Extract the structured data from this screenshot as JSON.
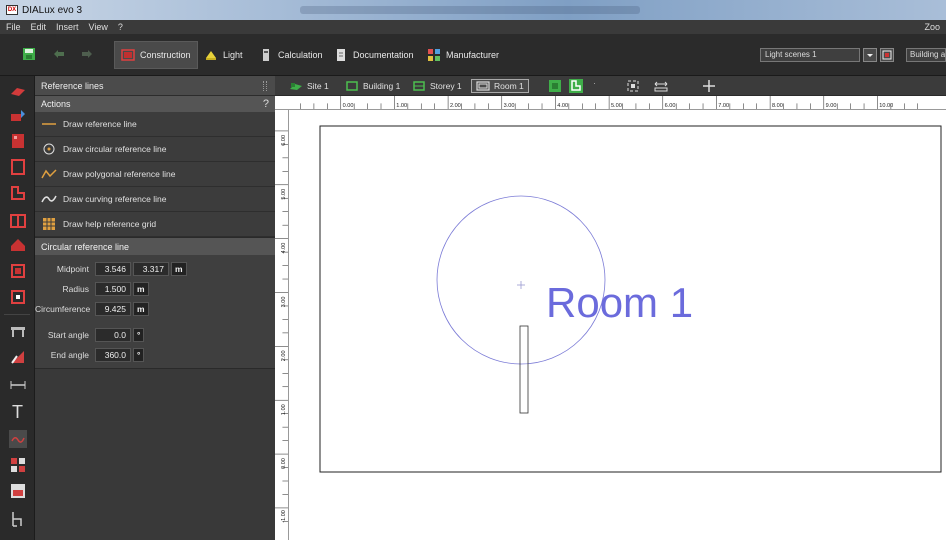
{
  "window": {
    "title": "DIALux evo 3"
  },
  "menu": {
    "items": [
      "File",
      "Edit",
      "Insert",
      "View",
      "?"
    ],
    "zoom": "Zoo"
  },
  "toolbar": {
    "construction": "Construction",
    "light": "Light",
    "calculation": "Calculation",
    "documentation": "Documentation",
    "manufacturer": "Manufacturer",
    "light_scenes": "Light scenes 1",
    "building_select": "Building a"
  },
  "panel": {
    "header": "Reference lines",
    "actions_title": "Actions",
    "help": "?",
    "actions": [
      "Draw reference line",
      "Draw circular reference line",
      "Draw polygonal reference line",
      "Draw curving reference line",
      "Draw help reference grid"
    ],
    "section_title": "Circular reference line",
    "props": {
      "midpoint_label": "Midpoint",
      "midpoint_x": "3.546",
      "midpoint_y": "3.317",
      "radius_label": "Radius",
      "radius": "1.500",
      "circ_label": "Circumference",
      "circumference": "9.425",
      "start_label": "Start angle",
      "start_angle": "0.0",
      "end_label": "End angle",
      "end_angle": "360.0",
      "unit_m": "m",
      "unit_deg": "°"
    }
  },
  "breadcrumb": [
    "Site 1",
    "Building 1",
    "Storey 1",
    "Room 1"
  ],
  "rulers": {
    "h_labels": [
      "0.00",
      "1.00",
      "2.00",
      "3.00",
      "4.00",
      "5.00",
      "6.00",
      "7.00",
      "8.00",
      "9.00",
      "10.00"
    ],
    "v_labels": [
      "6.00",
      "5.00",
      "4.00",
      "3.00",
      "2.00",
      "1.00",
      "0.00",
      "-1.00"
    ]
  },
  "canvas": {
    "room_label": "Room 1",
    "accent": "#6b6bdc",
    "circle": {
      "cx": 3.546,
      "cy": 3.317,
      "r": 1.5
    }
  }
}
